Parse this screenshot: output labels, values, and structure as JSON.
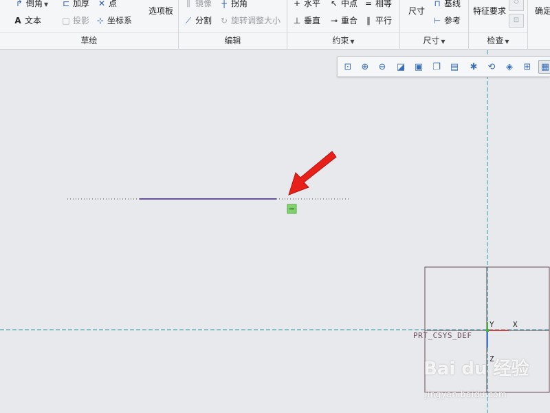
{
  "ribbon": {
    "sketch": {
      "label": "草绘",
      "fillet": "倒角",
      "thicken": "加厚",
      "point": "点",
      "text": "文本",
      "project": "投影",
      "csys": "坐标系",
      "palette": "选项板"
    },
    "edit": {
      "label": "编辑",
      "mirror": "镜像",
      "modify": "拐角",
      "divide": "分割",
      "rotate_resize": "旋转调整大小"
    },
    "constrain": {
      "label": "约束",
      "horizontal": "水平",
      "midpoint": "中点",
      "equal": "相等",
      "vertical": "垂直",
      "coincident": "重合",
      "parallel": "平行"
    },
    "dimension": {
      "label": "尺寸",
      "dimension": "尺寸",
      "baseline": "基线",
      "reference": "参考"
    },
    "inspect": {
      "label": "检查",
      "feature_req": "特征要求"
    },
    "ok": "确定"
  },
  "view_toolbar": {
    "icons": [
      "refit-icon",
      "zoom-in-icon",
      "zoom-out-icon",
      "repaint-icon",
      "display-style-icon",
      "saved-views-icon",
      "view-orientation-icon",
      "datum-display-icon",
      "sketch-display-icon",
      "spin-center-icon",
      "3d-view-icon",
      "sketch-view-icon"
    ]
  },
  "canvas": {
    "csys_label": "PRT_CSYS_DEF",
    "axis_x": "X",
    "axis_y": "Y",
    "axis_z": "Z",
    "horizontal_constraint_symbol": "—"
  },
  "watermark": {
    "logo": "Bai du 经验",
    "url": "jingyan.baidu.com"
  },
  "colors": {
    "centerline": "#2a9aa6",
    "sketch_line": "#3a1f7a",
    "arrow": "#e8201a",
    "constraint_badge": "#7fd36a"
  }
}
